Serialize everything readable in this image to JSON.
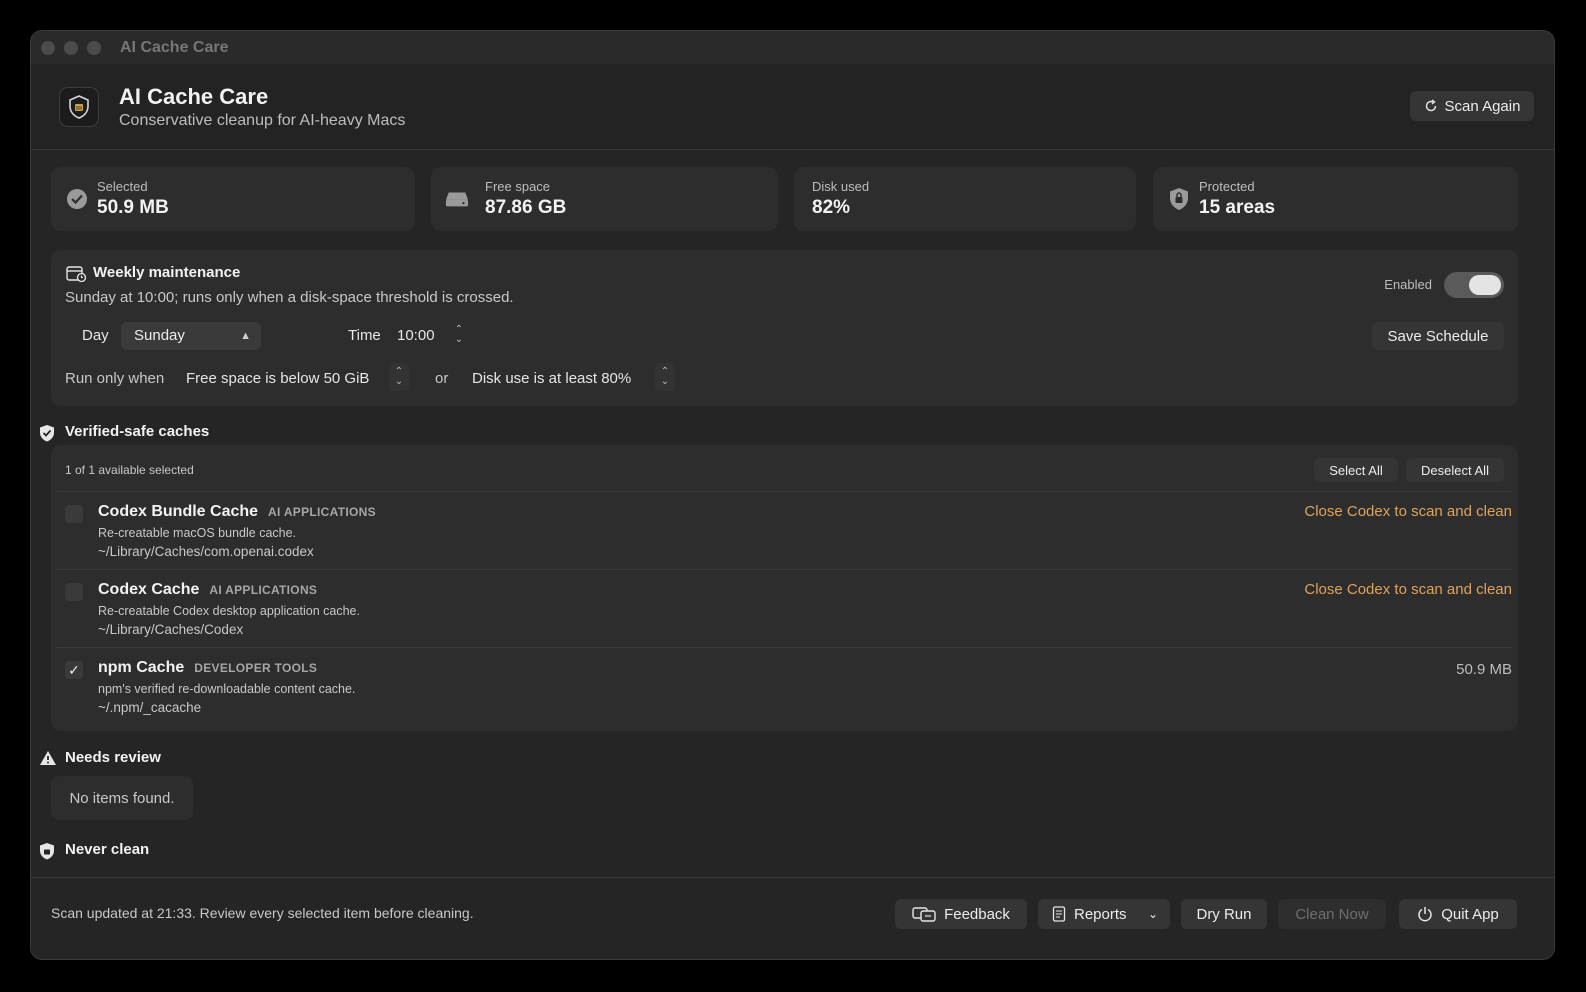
{
  "window": {
    "title": "AI Cache Care"
  },
  "header": {
    "app_name": "AI Cache Care",
    "subtitle": "Conservative cleanup for AI-heavy Macs",
    "scan_button": "Scan Again"
  },
  "stats": [
    {
      "label": "Selected",
      "value": "50.9 MB",
      "icon": "checkmark-circle-icon"
    },
    {
      "label": "Free space",
      "value": "87.86 GB",
      "icon": "drive-icon"
    },
    {
      "label": "Disk used",
      "value": "82%",
      "icon": ""
    },
    {
      "label": "Protected",
      "value": "15 areas",
      "icon": "lock-shield-icon"
    }
  ],
  "schedule": {
    "title": "Weekly maintenance",
    "description": "Sunday at 10:00; runs only when a disk-space threshold is crossed.",
    "enabled_label": "Enabled",
    "enabled": true,
    "day_label": "Day",
    "day_value": "Sunday",
    "time_label": "Time",
    "time_value": "10:00",
    "save_button": "Save Schedule",
    "run_only_when": "Run only when",
    "condition_free": "Free space is below 50 GiB",
    "or": "or",
    "condition_disk": "Disk use is at least 80%"
  },
  "verified": {
    "title": "Verified-safe caches",
    "summary": "1 of 1 available selected",
    "select_all": "Select All",
    "deselect_all": "Deselect All",
    "items": [
      {
        "name": "Codex Bundle Cache",
        "category": "AI APPLICATIONS",
        "description": "Re-creatable macOS bundle cache.",
        "path": "~/Library/Caches/com.openai.codex",
        "status": "Close Codex to scan and clean",
        "checked": false
      },
      {
        "name": "Codex Cache",
        "category": "AI APPLICATIONS",
        "description": "Re-creatable Codex desktop application cache.",
        "path": "~/Library/Caches/Codex",
        "status": "Close Codex to scan and clean",
        "checked": false
      },
      {
        "name": "npm Cache",
        "category": "DEVELOPER TOOLS",
        "description": "npm's verified re-downloadable content cache.",
        "path": "~/.npm/_cacache",
        "size": "50.9 MB",
        "checked": true
      }
    ]
  },
  "needs_review": {
    "title": "Needs review",
    "empty": "No items found."
  },
  "never_clean": {
    "title": "Never clean"
  },
  "footer": {
    "status": "Scan updated at 21:33. Review every selected item before cleaning.",
    "feedback": "Feedback",
    "reports": "Reports",
    "dry_run": "Dry Run",
    "clean_now": "Clean Now",
    "quit": "Quit App"
  },
  "colors": {
    "accent_warning": "#e0a35a",
    "panel": "#2d2d2d",
    "background": "#252525"
  }
}
